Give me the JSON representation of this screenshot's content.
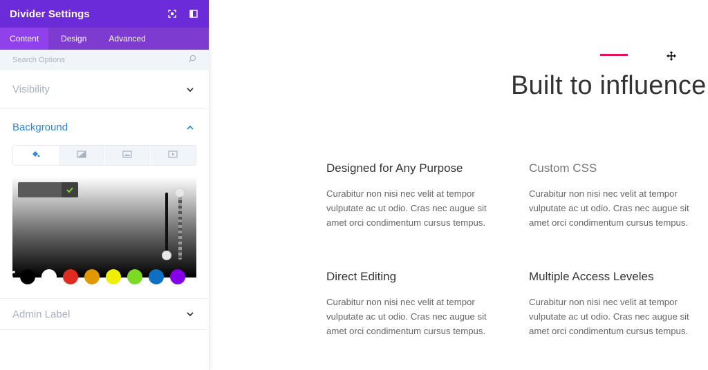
{
  "panel": {
    "title": "Divider Settings",
    "header_icons": [
      "fullscreen-icon",
      "sidebar-toggle-icon"
    ],
    "tabs": [
      {
        "label": "Content",
        "active": true
      },
      {
        "label": "Design",
        "active": false
      },
      {
        "label": "Advanced",
        "active": false
      }
    ],
    "search": {
      "placeholder": "Search Options",
      "icon": "search-icon"
    },
    "sections": {
      "visibility": {
        "label": "Visibility",
        "state": "collapsed"
      },
      "background": {
        "label": "Background",
        "state": "expanded"
      },
      "admin_label": {
        "label": "Admin Label",
        "state": "collapsed"
      }
    },
    "background_tabs": [
      "color-icon",
      "gradient-icon",
      "image-icon",
      "video-icon"
    ],
    "color_picker": {
      "hex_value": "",
      "swatches": [
        "#000000",
        "#ffffff",
        "#e02b20",
        "#e09900",
        "#edf000",
        "#7cda24",
        "#0c71c3",
        "#8300e9"
      ]
    },
    "colors": {
      "header": "#6c2bd9",
      "accent": "#2b87da",
      "muted": "#a8b1bf"
    }
  },
  "canvas": {
    "divider_color": "#e0115f",
    "hero_title": "Built to influence",
    "features": [
      {
        "title": "Designed for Any Purpose",
        "body": "Curabitur non nisi nec velit at tempor vulputate ac ut odio. Cras nec augue sit amet orci condimentum cursus tempus."
      },
      {
        "title": "Custom CSS",
        "body": "Curabitur non nisi nec velit at tempor vulputate ac ut odio. Cras nec augue sit amet orci condimentum cursus tempus."
      },
      {
        "title": "Direct Editing",
        "body": "Curabitur non nisi nec velit at tempor vulputate ac ut odio. Cras nec augue sit amet orci condimentum cursus tempus."
      },
      {
        "title": "Multiple Access Leveles",
        "body": "Curabitur non nisi nec velit at tempor vulputate ac ut odio. Cras nec augue sit amet orci condimentum cursus tempus."
      }
    ]
  }
}
